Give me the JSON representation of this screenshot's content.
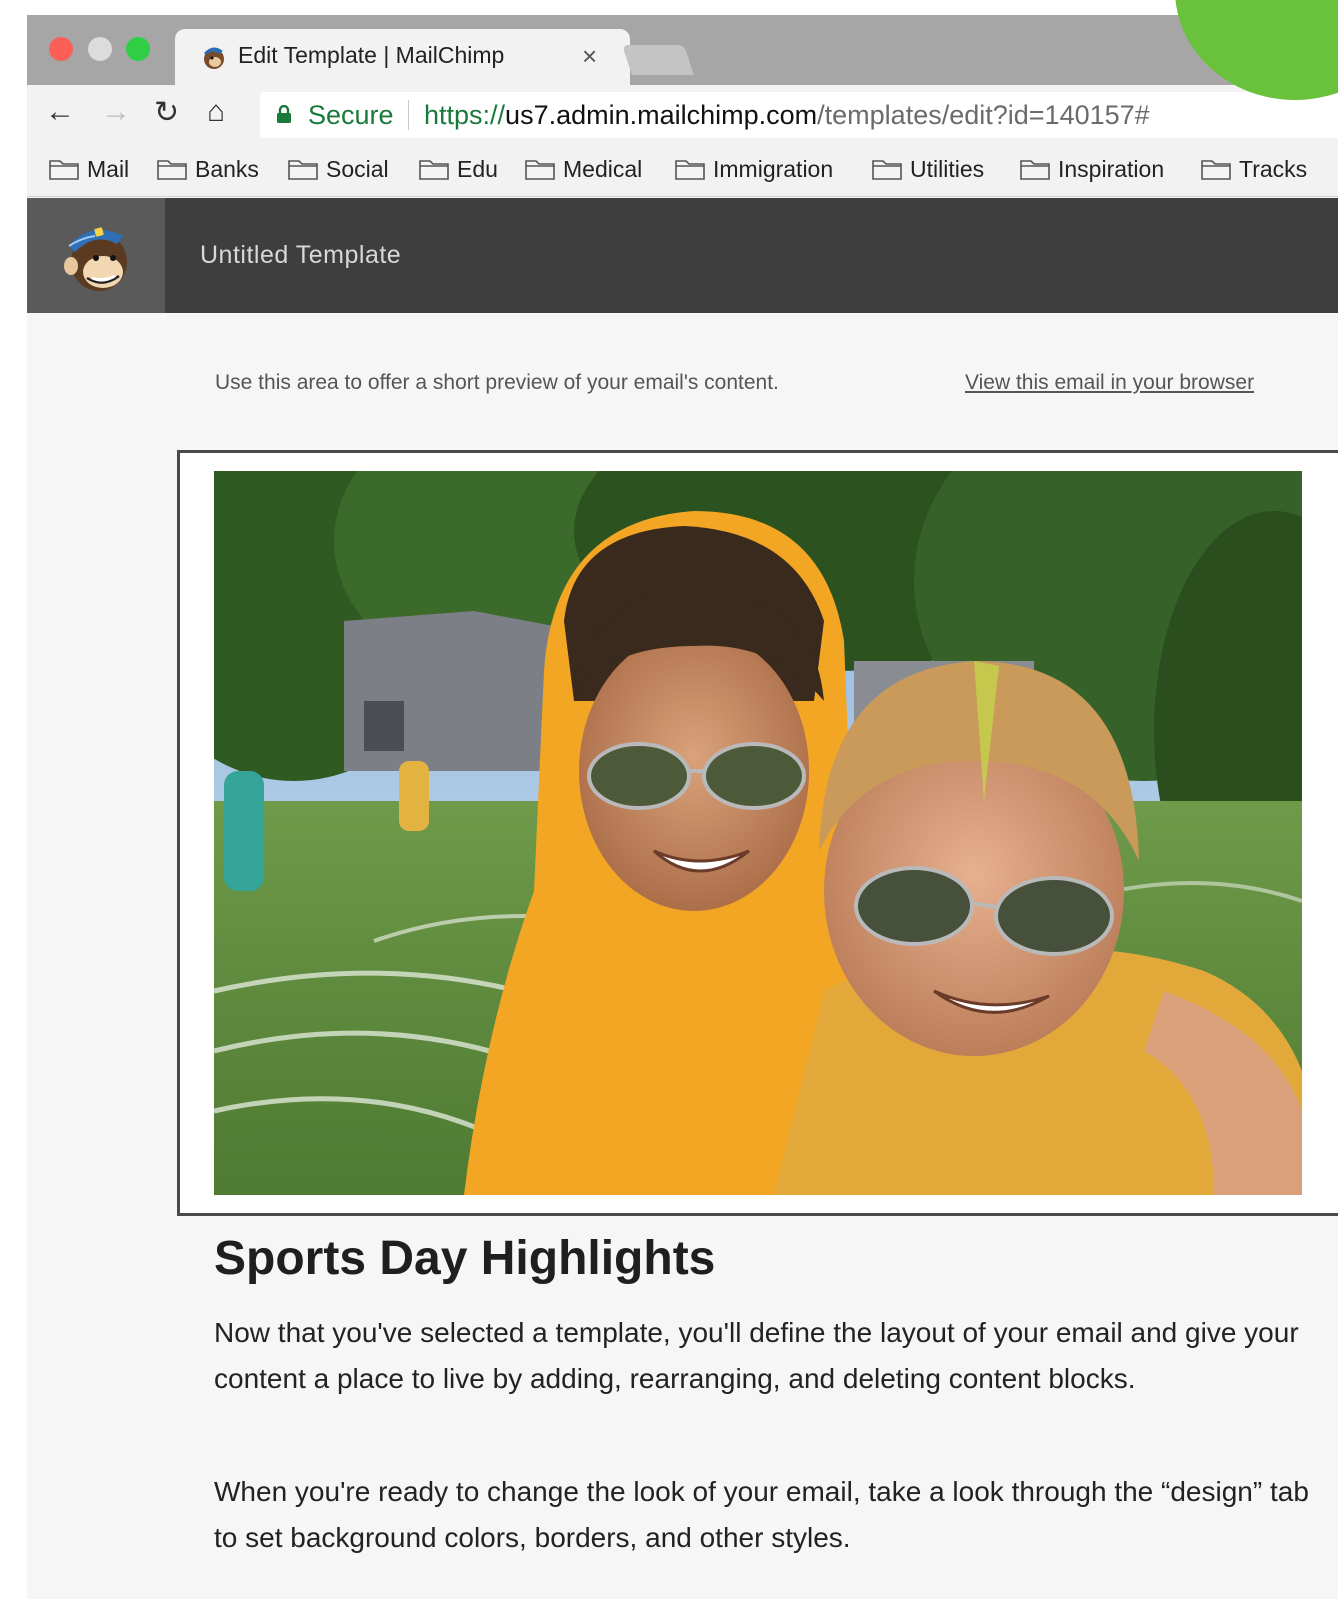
{
  "browser": {
    "tab_title": "Edit Template | MailChimp",
    "tab_close": "×",
    "nav": {
      "back": "←",
      "forward": "→",
      "reload": "↻",
      "home": "⌂"
    },
    "secure_label": "Secure",
    "url": {
      "scheme": "https://",
      "host": "us7.admin.mailchimp.com",
      "path": "/templates/edit?id=140157#"
    },
    "bookmarks": [
      "Mail",
      "Banks",
      "Social",
      "Edu",
      "Medical",
      "Immigration",
      "Utilities",
      "Inspiration",
      "Tracks"
    ]
  },
  "editor": {
    "template_title": "Untitled Template"
  },
  "email": {
    "preheader": "Use this area to offer a short preview of your email's content.",
    "view_in_browser": "View this email in your browser",
    "heading": "Sports Day Highlights",
    "paragraphs": [
      "Now that you've selected a template, you'll define the layout of your email and give your content a place to live by adding, rearranging, and deleting content blocks.",
      "When you're ready to change the look of your email, take a look through the “design” tab to set background colors, borders, and other styles."
    ]
  },
  "colors": {
    "secure_green": "#1a7a3b",
    "editor_header": "#3e3e3e",
    "accent_circle": "#6ac13c"
  }
}
